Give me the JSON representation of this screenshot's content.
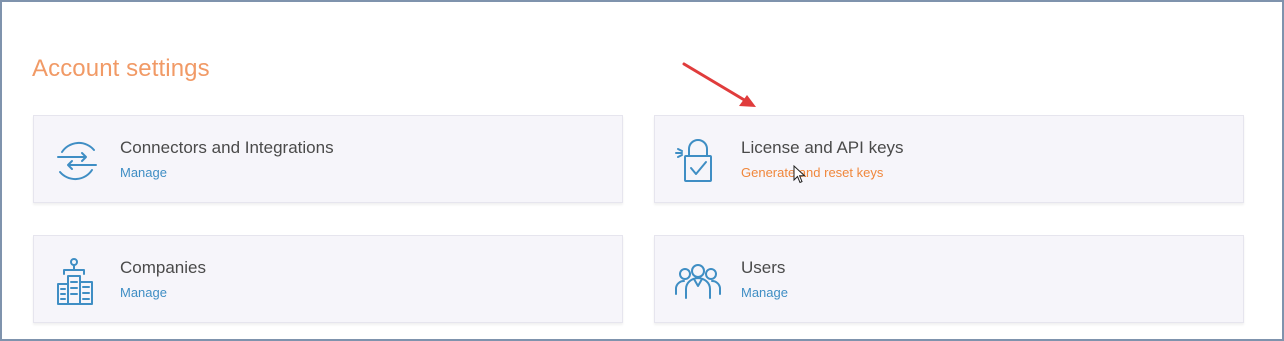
{
  "page": {
    "title": "Account settings"
  },
  "cards": [
    {
      "heading": "Connectors and Integrations",
      "link": "Manage",
      "icon": "connectors-arrows-icon"
    },
    {
      "heading": "License and API keys",
      "link": "Generate and reset keys",
      "icon": "padlock-check-icon"
    },
    {
      "heading": "Companies",
      "link": "Manage",
      "icon": "companies-buildings-icon"
    },
    {
      "heading": "Users",
      "link": "Manage",
      "icon": "users-group-icon"
    }
  ],
  "colors": {
    "title": "#f19a66",
    "link": "#3f8ec4",
    "link_active": "#f0873c",
    "icon": "#3f8ec4",
    "annotation_arrow": "#e03c3c"
  },
  "annotation": {
    "type": "red-arrow-pointer",
    "target": "License and API keys"
  }
}
